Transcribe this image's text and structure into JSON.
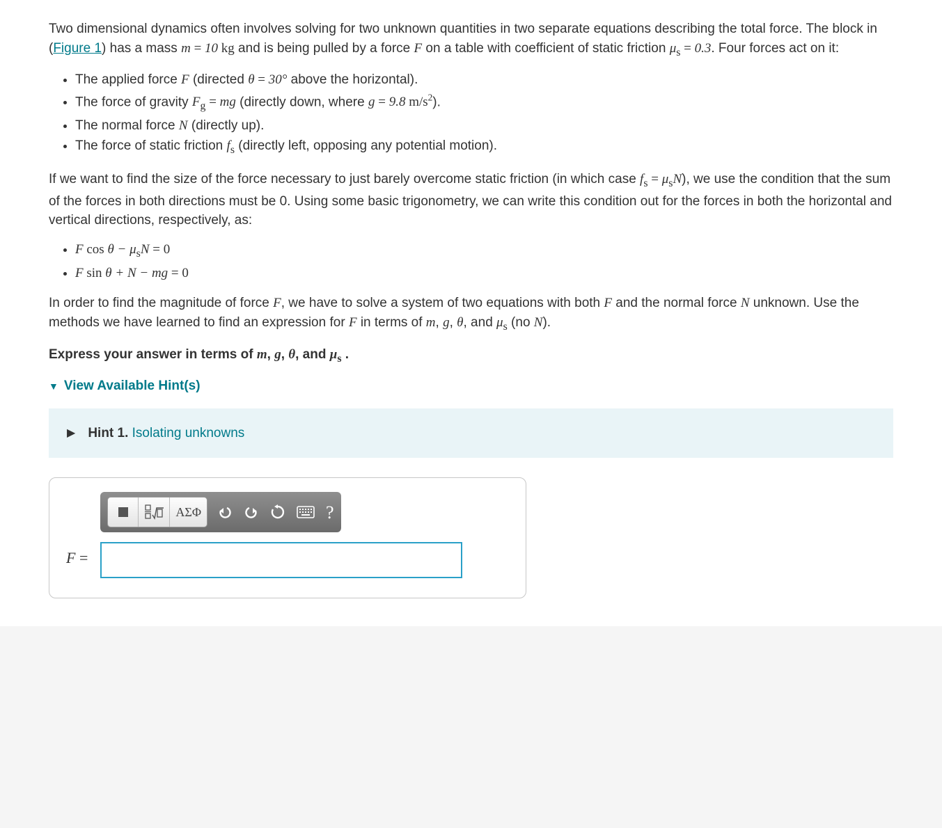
{
  "intro": {
    "pre_figure": "Two dimensional dynamics often involves solving for two unknown quantities in two separate equations describing the total force. The block in (",
    "figure_link": "Figure 1",
    "post_figure_a": ") has a mass ",
    "mass_expr": "m = 10 kg",
    "post_figure_b": " and is being pulled by a force ",
    "F": "F",
    "post_figure_c": " on a table with coefficient of static friction ",
    "mu_expr": "μ",
    "mu_sub": "s",
    "mu_val": " = 0.3",
    "post_figure_d": ". Four forces act on it:"
  },
  "forces": [
    {
      "pre": "The applied force ",
      "sym": "F",
      "mid": " (directed ",
      "expr": "θ = 30°",
      "post": " above the horizontal)."
    },
    {
      "pre": "The force of gravity ",
      "sym": "F",
      "sub": "g",
      "mid": " = ",
      "expr": "mg",
      "aft": " (directly down, where ",
      "g": "g = 9.8 m/s",
      "sup": "2",
      "post": ")."
    },
    {
      "pre": "The normal force ",
      "sym": "N",
      "post": " (directly up)."
    },
    {
      "pre": "The force of static friction ",
      "sym": "f",
      "sub": "s",
      "post": " (directly left, opposing any potential motion)."
    }
  ],
  "cond": {
    "a": "If we want to find the size of the force necessary to just barely overcome static friction (in which case ",
    "fsmu": "f",
    "fs_sub": "s",
    "eq": " = μ",
    "mu_sub": "s",
    "N": "N",
    "b": "), we use the condition that the sum of the forces in both directions must be 0. Using some basic trigonometry, we can write this condition out for the forces in both the horizontal and vertical directions, respectively, as:"
  },
  "eqs": [
    "F cos θ − μ_s N = 0",
    "F sin θ + N − mg = 0"
  ],
  "solve": {
    "a": "In order to find the magnitude of force ",
    "F": "F",
    "b": ", we have to solve a system of two equations with both ",
    "F2": "F",
    "c": " and the normal force ",
    "N": "N",
    "d": " unknown. Use the methods we have learned to find an expression for ",
    "F3": "F",
    "e": " in terms of ",
    "m": "m",
    "g": "g",
    "th": "θ",
    "mu": "μ",
    "mu_sub": "s",
    "noN_a": " (no ",
    "noN_N": "N",
    "noN_b": ")."
  },
  "express": {
    "pre": "Express your answer in terms of ",
    "m": "m",
    "g": "g",
    "th": "θ",
    "mu": "μ",
    "mu_sub": "s",
    "post": " ."
  },
  "hints_toggle": "View Available Hint(s)",
  "hint1": {
    "title": "Hint 1.",
    "subtitle": "Isolating unknowns"
  },
  "answer": {
    "label_sym": "F",
    "label_eq": " = "
  },
  "toolbar": {
    "greek_label": "ΑΣΦ"
  }
}
